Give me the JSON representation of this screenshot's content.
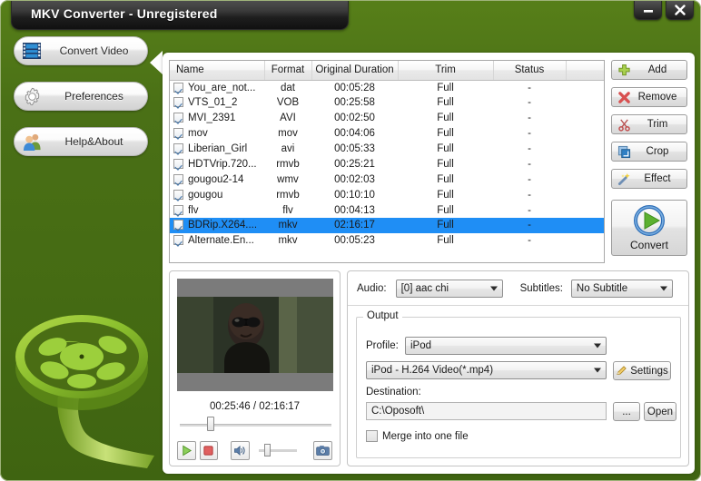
{
  "window": {
    "title": "MKV Converter - Unregistered",
    "minimize_icon": "minimize-icon",
    "close_icon": "close-icon",
    "accent_green": "#4a7016",
    "titlebar_dark": "#1e1e1e",
    "selection_blue": "#1f8ef5"
  },
  "sidebar": {
    "items": [
      {
        "label": "Convert Video",
        "icon": "film-strip-icon",
        "active": true
      },
      {
        "label": "Preferences",
        "icon": "gear-icon",
        "active": false
      },
      {
        "label": "Help&About",
        "icon": "people-icon",
        "active": false
      }
    ]
  },
  "file_table": {
    "columns": [
      "Name",
      "Format",
      "Original Duration",
      "Trim",
      "Status",
      ""
    ],
    "rows": [
      {
        "checked": true,
        "name": "You_are_not...",
        "format": "dat",
        "duration": "00:05:28",
        "trim": "Full",
        "status": "-",
        "selected": false
      },
      {
        "checked": true,
        "name": "VTS_01_2",
        "format": "VOB",
        "duration": "00:25:58",
        "trim": "Full",
        "status": "-",
        "selected": false
      },
      {
        "checked": true,
        "name": "MVI_2391",
        "format": "AVI",
        "duration": "00:02:50",
        "trim": "Full",
        "status": "-",
        "selected": false
      },
      {
        "checked": true,
        "name": "mov",
        "format": "mov",
        "duration": "00:04:06",
        "trim": "Full",
        "status": "-",
        "selected": false
      },
      {
        "checked": true,
        "name": "Liberian_Girl",
        "format": "avi",
        "duration": "00:05:33",
        "trim": "Full",
        "status": "-",
        "selected": false
      },
      {
        "checked": true,
        "name": "HDTVrip.720...",
        "format": "rmvb",
        "duration": "00:25:21",
        "trim": "Full",
        "status": "-",
        "selected": false
      },
      {
        "checked": true,
        "name": "gougou2-14",
        "format": "wmv",
        "duration": "00:02:03",
        "trim": "Full",
        "status": "-",
        "selected": false
      },
      {
        "checked": true,
        "name": "gougou",
        "format": "rmvb",
        "duration": "00:10:10",
        "trim": "Full",
        "status": "-",
        "selected": false
      },
      {
        "checked": true,
        "name": "flv",
        "format": "flv",
        "duration": "00:04:13",
        "trim": "Full",
        "status": "-",
        "selected": false
      },
      {
        "checked": true,
        "name": "BDRip.X264....",
        "format": "mkv",
        "duration": "02:16:17",
        "trim": "Full",
        "status": "-",
        "selected": true
      },
      {
        "checked": true,
        "name": "Alternate.En...",
        "format": "mkv",
        "duration": "00:05:23",
        "trim": "Full",
        "status": "-",
        "selected": false
      }
    ]
  },
  "actions": {
    "buttons": [
      {
        "label": "Add",
        "icon": "plus-icon"
      },
      {
        "label": "Remove",
        "icon": "cross-icon"
      },
      {
        "label": "Trim",
        "icon": "scissors-icon"
      },
      {
        "label": "Crop",
        "icon": "crop-icon"
      },
      {
        "label": "Effect",
        "icon": "wand-icon"
      }
    ],
    "convert_label": "Convert",
    "convert_icon": "play-circle-icon"
  },
  "preview": {
    "time_display": "00:25:46 / 02:16:17",
    "current_time": "00:25:46",
    "total_time": "02:16:17",
    "seek_percent": 19,
    "volume_percent": 14,
    "play_icon": "play-icon",
    "stop_icon": "stop-icon",
    "volume_icon": "speaker-icon",
    "snapshot_icon": "camera-icon"
  },
  "settings": {
    "audio_label": "Audio:",
    "audio_value": "[0] aac chi",
    "subtitles_label": "Subtitles:",
    "subtitles_value": "No Subtitle",
    "output_legend": "Output",
    "profile_label": "Profile:",
    "profile_value": "iPod",
    "format_value": "iPod - H.264 Video(*.mp4)",
    "settings_button": "Settings",
    "settings_icon": "pencil-icon",
    "destination_label": "Destination:",
    "destination_value": "C:\\Oposoft\\",
    "browse_button": "...",
    "open_button": "Open",
    "merge_label": "Merge into one file",
    "merge_checked": false
  }
}
